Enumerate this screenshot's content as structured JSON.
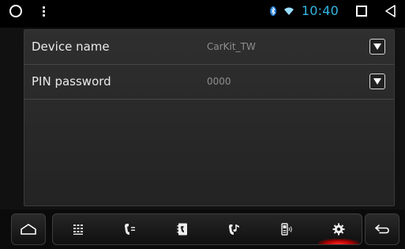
{
  "status_bar": {
    "time": "10:40",
    "left_icons": [
      "circle-icon",
      "overflow-menu-icon"
    ],
    "right_icons": [
      "bluetooth-icon",
      "wifi-icon",
      "recent-apps-icon",
      "back-icon"
    ],
    "time_color": "#33b5e5"
  },
  "settings": {
    "rows": [
      {
        "label": "Device name",
        "value": "CarKit_TW"
      },
      {
        "label": "PIN password",
        "value": "0000"
      }
    ]
  },
  "nav": {
    "tabs": [
      {
        "name": "dialpad",
        "icon": "dialpad-icon"
      },
      {
        "name": "call-log",
        "icon": "call-log-icon"
      },
      {
        "name": "contacts",
        "icon": "contacts-icon"
      },
      {
        "name": "music",
        "icon": "bluetooth-music-icon"
      },
      {
        "name": "phone-device",
        "icon": "phone-device-icon"
      },
      {
        "name": "settings",
        "icon": "gear-icon",
        "active": true
      }
    ],
    "active_color": "#ff2a2a"
  }
}
